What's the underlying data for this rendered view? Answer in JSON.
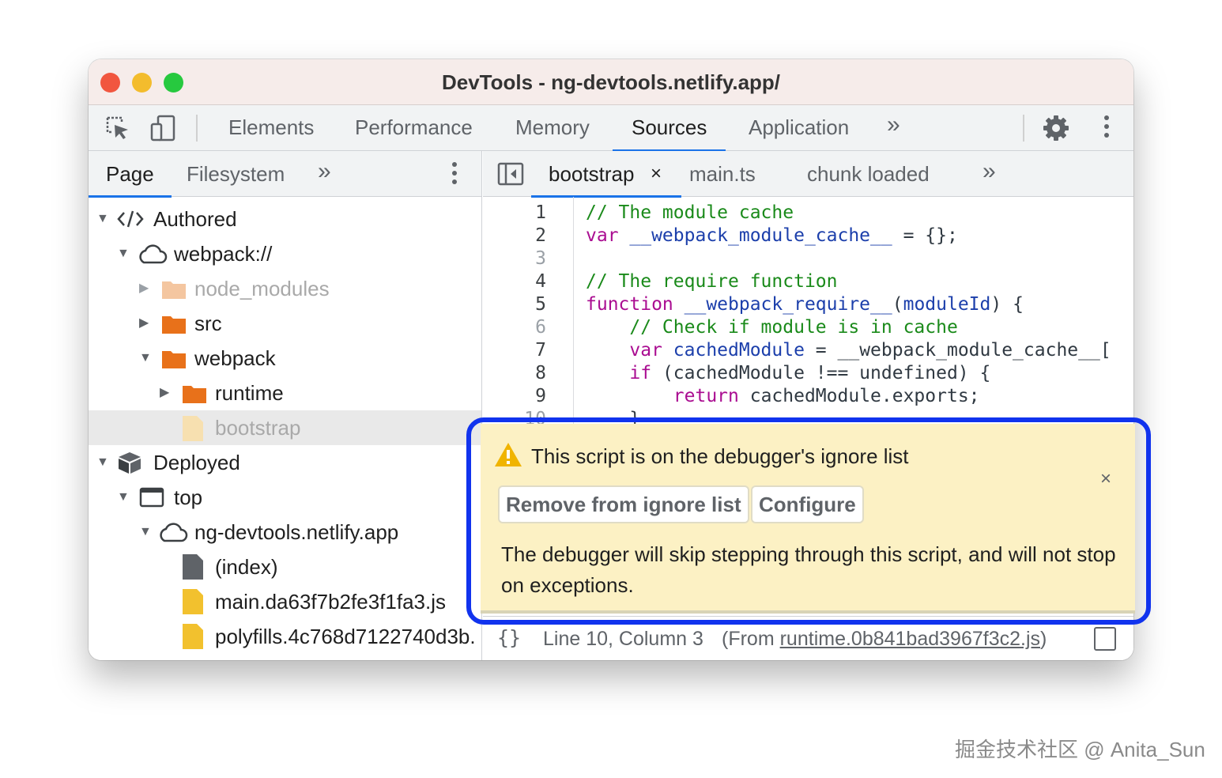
{
  "window": {
    "title": "DevTools - ng-devtools.netlify.app/"
  },
  "toolbar": {
    "icons": [
      "inspect-icon",
      "device-toggle-icon",
      "gear-icon",
      "more-vert-icon"
    ],
    "tabs": [
      "Elements",
      "Performance",
      "Memory",
      "Sources",
      "Application"
    ],
    "active_tab": "Sources",
    "overflow": "»"
  },
  "navigator": {
    "tabs": [
      "Page",
      "Filesystem"
    ],
    "active_tab": "Page",
    "overflow": "»",
    "tree": [
      {
        "label": "Authored",
        "expanded": true,
        "icon": "code-icon"
      },
      {
        "label": "webpack://",
        "expanded": true,
        "icon": "cloud-icon"
      },
      {
        "label": "node_modules",
        "expanded": false,
        "icon": "folder-icon",
        "dimmed": true
      },
      {
        "label": "src",
        "expanded": false,
        "icon": "folder-icon"
      },
      {
        "label": "webpack",
        "expanded": true,
        "icon": "folder-icon"
      },
      {
        "label": "runtime",
        "expanded": false,
        "icon": "folder-icon"
      },
      {
        "label": "bootstrap",
        "icon": "file-icon",
        "selected": true,
        "dimmed": true
      },
      {
        "label": "Deployed",
        "expanded": true,
        "icon": "box-icon"
      },
      {
        "label": "top",
        "expanded": true,
        "icon": "frame-icon"
      },
      {
        "label": "ng-devtools.netlify.app",
        "expanded": true,
        "icon": "cloud-icon"
      },
      {
        "label": "(index)",
        "icon": "document-icon"
      },
      {
        "label": "main.da63f7b2fe3f1fa3.js",
        "icon": "script-file-icon"
      },
      {
        "label": "polyfills.4c768d7122740d3b.",
        "icon": "script-file-icon"
      }
    ]
  },
  "editor": {
    "tabs": [
      "bootstrap",
      "main.ts",
      "chunk loaded"
    ],
    "active_tab": "bootstrap",
    "close_glyph": "×",
    "overflow": "»",
    "line_numbers": [
      "1",
      "2",
      "3",
      "4",
      "5",
      "6",
      "7",
      "8",
      "9",
      "10"
    ],
    "lines": [
      [
        {
          "t": "// The module cache",
          "s": "c"
        }
      ],
      [
        {
          "t": "var ",
          "s": "k"
        },
        {
          "t": "__webpack_module_cache__",
          "s": "v"
        },
        {
          "t": " = {};",
          "s": "p"
        }
      ],
      [],
      [
        {
          "t": "// The require function",
          "s": "c"
        }
      ],
      [
        {
          "t": "function ",
          "s": "k"
        },
        {
          "t": "__webpack_require__",
          "s": "v"
        },
        {
          "t": "(",
          "s": "p"
        },
        {
          "t": "moduleId",
          "s": "v"
        },
        {
          "t": ") {",
          "s": "p"
        }
      ],
      [
        {
          "t": "    // Check if module is in cache",
          "s": "c"
        }
      ],
      [
        {
          "t": "    var ",
          "s": "k"
        },
        {
          "t": "cachedModule",
          "s": "v"
        },
        {
          "t": " = __webpack_module_cache__[",
          "s": "p"
        }
      ],
      [
        {
          "t": "    if ",
          "s": "k"
        },
        {
          "t": "(cachedModule !== undefined) {",
          "s": "p"
        }
      ],
      [
        {
          "t": "        return ",
          "s": "k"
        },
        {
          "t": "cachedModule.exports;",
          "s": "p"
        }
      ],
      [
        {
          "t": "    }",
          "s": "p"
        }
      ]
    ]
  },
  "status": {
    "braces": "{}",
    "position": "Line 10, Column 3",
    "from_prefix": "(From ",
    "from_link": "runtime.0b841bad3967f3c2.js",
    "from_suffix": ")"
  },
  "infobar": {
    "title": "This script is on the debugger's ignore list",
    "remove_button": "Remove from ignore list",
    "configure_button": "Configure",
    "description": "The debugger will skip stepping through this script, and will not stop on exceptions.",
    "close_glyph": "×",
    "icon": "warning-icon",
    "highlight_color": "#1133ee"
  },
  "watermark": "掘金技术社区 @ Anita_Sun"
}
